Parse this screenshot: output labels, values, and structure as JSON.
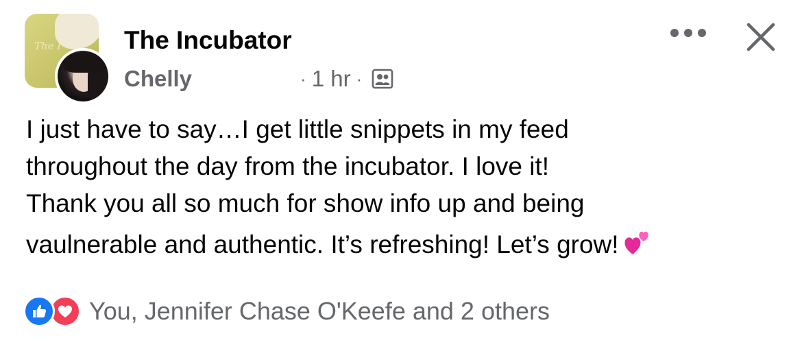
{
  "post": {
    "group_name": "The Incubator",
    "author": "Chelly",
    "separator": "·",
    "time": "1 hr",
    "audience_icon": "members-icon",
    "text_lines": [
      "I just have to say…I get little snippets in my feed",
      "throughout the day from the incubator. I love it!",
      "Thank you all so much for show info up and being",
      "vaulnerable and authentic. It’s refreshing! Let’s grow!"
    ],
    "emoji": "two-hearts-icon"
  },
  "controls": {
    "more_icon": "more-horizontal-icon",
    "close_icon": "close-icon"
  },
  "reactions": {
    "icons": [
      "like-icon",
      "love-icon"
    ],
    "summary": "You, Jennifer Chase O'Keefe and 2 others"
  },
  "colors": {
    "primary_text": "#050505",
    "secondary_text": "#65676b",
    "like_blue": "#1877f2",
    "love_red": "#f33e58",
    "emoji_pink": "#ff4fa8"
  }
}
